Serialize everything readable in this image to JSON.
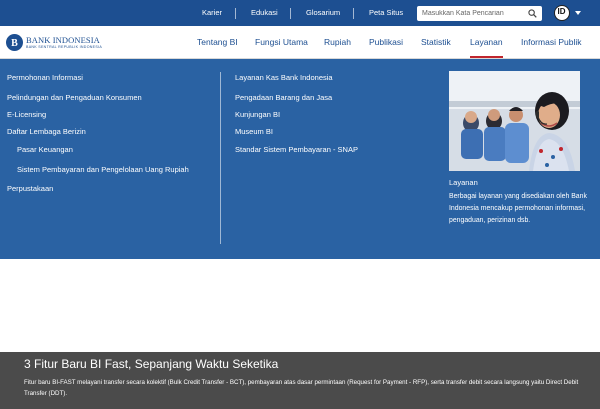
{
  "topbar": {
    "links": [
      "Karier",
      "Edukasi",
      "Glosarium",
      "Peta Situs"
    ],
    "search_placeholder": "Masukkan Kata Pencarian",
    "search_icon": "search-icon",
    "language": "ID",
    "bg_color": "#1d4f91"
  },
  "header": {
    "logo_name": "BANK INDONESIA",
    "logo_sub": "BANK SENTRAL REPUBLIK INDONESIA",
    "nav": [
      {
        "label": "Tentang BI"
      },
      {
        "label": "Fungsi Utama"
      },
      {
        "label": "Rupiah"
      },
      {
        "label": "Publikasi"
      },
      {
        "label": "Statistik"
      },
      {
        "label": "Layanan",
        "active": true
      },
      {
        "label": "Informasi Publik"
      }
    ],
    "active_color": "#c0262d"
  },
  "mega_menu": {
    "bg_color": "#2a62a3",
    "col1": [
      "Permohonan Informasi",
      "Pelindungan dan Pengaduan Konsumen",
      "E-Licensing",
      "Daftar Lembaga Berizin",
      "Pasar Keuangan",
      "Sistem Pembayaran dan Pengelolaan Uang Rupiah",
      "Perpustakaan"
    ],
    "col2": [
      "Layanan Kas Bank Indonesia",
      "Pengadaan Barang dan Jasa",
      "Kunjungan BI",
      "Museum BI",
      "Standar Sistem Pembayaran - SNAP"
    ],
    "promo": {
      "title": "Layanan",
      "description": "Berbagai layanan yang disediakan oleh Bank Indonesia mencakup permohonan informasi, pengaduan, perizinan dsb."
    }
  },
  "hero": {
    "title": "3 Fitur Baru BI Fast, Sepanjang Waktu Seketika",
    "description": "Fitur baru BI-FAST melayani transfer secara kolektif (Bulk Credit Transfer - BCT), pembayaran atas dasar permintaan (Request for Payment - RFP), serta transfer debit secara langsung yaitu Direct Debit Transfer (DDT)."
  }
}
